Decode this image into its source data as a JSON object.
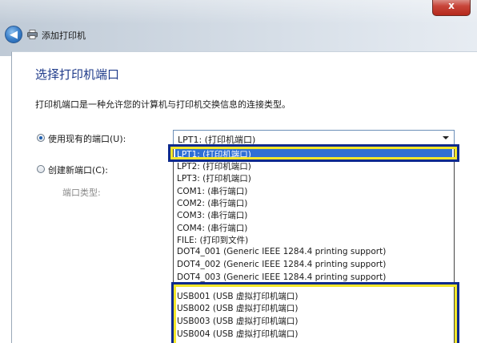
{
  "window": {
    "title": "添加打印机",
    "close_glyph": "x",
    "back_glyph": "◀",
    "icons": [
      "back-arrow-icon",
      "printer-icon",
      "close-icon"
    ]
  },
  "page": {
    "title": "选择打印机端口",
    "description": "打印机端口是一种允许您的计算机与打印机交换信息的连接类型。"
  },
  "options": {
    "use_existing_label": "使用现有的端口(U):",
    "create_new_label": "创建新端口(C):",
    "port_type_label": "端口类型:"
  },
  "combo": {
    "selected": "LPT1: (打印机端口)"
  },
  "ports": [
    "LPT1: (打印机端口)",
    "LPT2: (打印机端口)",
    "LPT3: (打印机端口)",
    "COM1: (串行端口)",
    "COM2: (串行端口)",
    "COM3: (串行端口)",
    "COM4: (串行端口)",
    "FILE: (打印到文件)",
    "DOT4_001 (Generic IEEE 1284.4 printing support)",
    "DOT4_002 (Generic IEEE 1284.4 printing support)",
    "DOT4_003 (Generic IEEE 1284.4 printing support)",
    "USB001 (USB 虚拟打印机端口)",
    "USB002 (USB 虚拟打印机端口)",
    "USB003 (USB 虚拟打印机端口)",
    "USB004 (USB 虚拟打印机端口)"
  ],
  "colors": {
    "selection": "#2f6fd4",
    "highlight_outer": "#0d2a8c",
    "highlight_inner": "#f3e62a",
    "title_blue": "#1e3a8a"
  }
}
